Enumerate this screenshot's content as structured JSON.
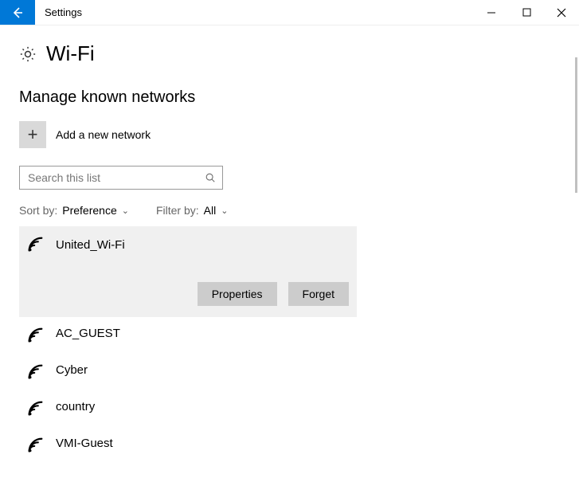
{
  "window": {
    "title": "Settings"
  },
  "page": {
    "heading": "Wi-Fi",
    "section": "Manage known networks"
  },
  "add": {
    "label": "Add a new network"
  },
  "search": {
    "placeholder": "Search this list"
  },
  "sort": {
    "label": "Sort by:",
    "value": "Preference"
  },
  "filter": {
    "label": "Filter by:",
    "value": "All"
  },
  "actions": {
    "properties": "Properties",
    "forget": "Forget"
  },
  "networks": [
    {
      "name": "United_Wi-Fi",
      "selected": true
    },
    {
      "name": "AC_GUEST",
      "selected": false
    },
    {
      "name": "Cyber",
      "selected": false
    },
    {
      "name": "country",
      "selected": false
    },
    {
      "name": "VMI-Guest",
      "selected": false
    }
  ]
}
